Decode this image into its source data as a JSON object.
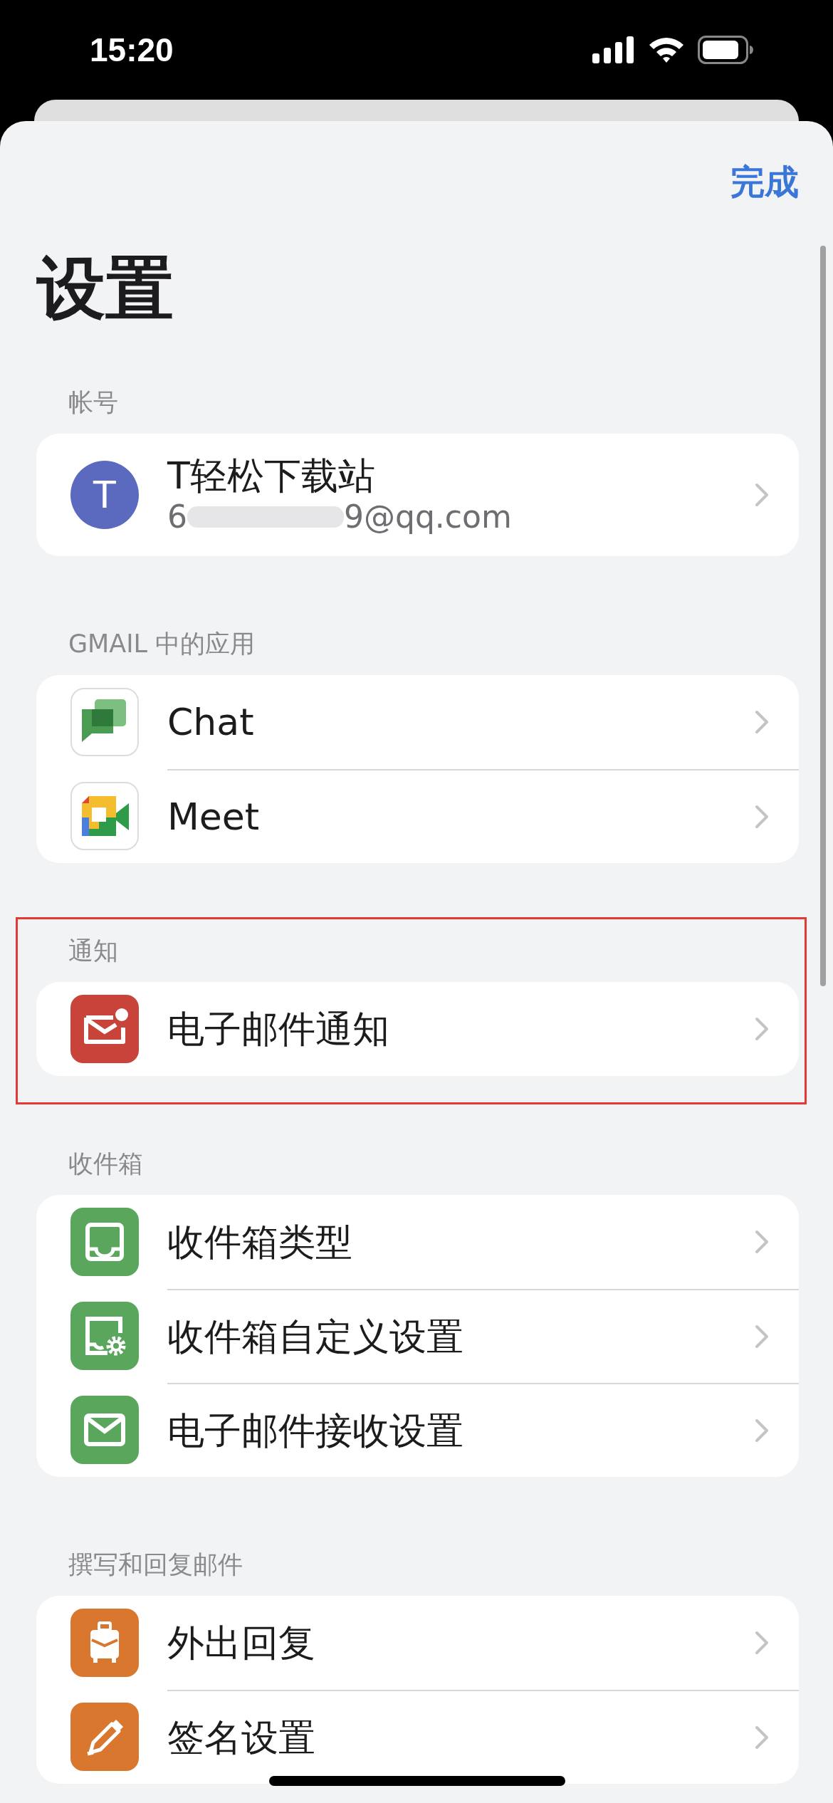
{
  "status_bar": {
    "time": "15:20"
  },
  "done_button": "完成",
  "title": "设置",
  "sections": [
    {
      "header": "帐号",
      "highlighted": false,
      "rows": [
        {
          "kind": "account",
          "avatar": "T",
          "title": "T轻松下载站",
          "email_start": "6",
          "email_end": "9@qq.com"
        }
      ]
    },
    {
      "header": "GMAIL 中的应用",
      "highlighted": false,
      "rows": [
        {
          "kind": "chat",
          "title": "Chat"
        },
        {
          "kind": "meet",
          "title": "Meet"
        }
      ]
    },
    {
      "header": "通知",
      "highlighted": true,
      "rows": [
        {
          "kind": "mail-dot",
          "title": "电子邮件通知"
        }
      ]
    },
    {
      "header": "收件箱",
      "highlighted": false,
      "rows": [
        {
          "kind": "tray",
          "title": "收件箱类型"
        },
        {
          "kind": "tray-gear",
          "title": "收件箱自定义设置"
        },
        {
          "kind": "mail",
          "title": "电子邮件接收设置"
        }
      ]
    },
    {
      "header": "撰写和回复邮件",
      "highlighted": false,
      "rows": [
        {
          "kind": "suitcase",
          "title": "外出回复"
        },
        {
          "kind": "pen",
          "title": "签名设置"
        }
      ]
    }
  ]
}
